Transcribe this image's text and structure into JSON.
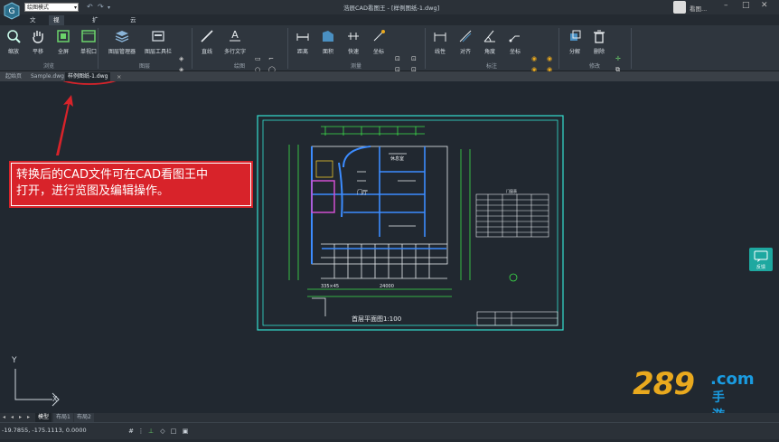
{
  "titlebar": {
    "mode": "绘图模式",
    "title": "浩辰CAD看图王 - [样例图纸-1.dwg]",
    "user": "看图..."
  },
  "menu": [
    "文件",
    "视图绘制",
    "扩展工具",
    "云批注"
  ],
  "ribbon": {
    "tools": [
      "缩放",
      "平移",
      "全屏",
      "单视口",
      "图层管理器",
      "图层工具栏",
      "直线",
      "多行文字",
      "距离",
      "面积",
      "快速",
      "坐标",
      "线性",
      "对齐",
      "角度",
      "坐标",
      "分解",
      "删除"
    ],
    "groups": [
      "浏览",
      "图层",
      "绘图",
      "测量",
      "标注",
      "修改"
    ]
  },
  "doc_tabs": [
    "起始页",
    "Sample.dwg",
    "样例图纸-1.dwg"
  ],
  "callout": {
    "line1": "转换后的CAD文件可在CAD看图王中",
    "line2": "打开，进行览图及编辑操作。"
  },
  "drawing": {
    "title": "首层平面图1:100",
    "room_a": "门厅",
    "room_b": "休息室",
    "table_title": "门窗表",
    "dim_a": "335×45",
    "dim_b": "24000"
  },
  "watermark": {
    "number": "289",
    "com": ".com",
    "cn": "手游网"
  },
  "side_widget": "反馈",
  "layout_tabs": [
    "模型",
    "布局1",
    "布局2"
  ],
  "status": {
    "coords": "-19.7855, -175.1113, 0.0000"
  },
  "colors": {
    "accent": "#d8232a",
    "cad_cyan": "#35e0d0",
    "cad_green": "#3ce04a",
    "watermark_orange": "#e9a91e",
    "watermark_blue": "#1a9be0"
  }
}
